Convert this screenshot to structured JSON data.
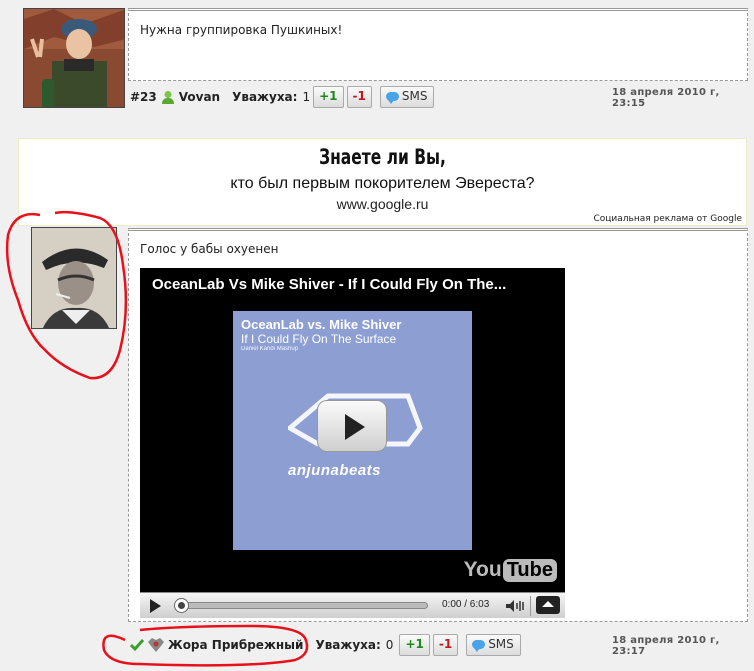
{
  "post1": {
    "message": "Нужна группировка Пушкиных!",
    "number": "#23",
    "username": "Vovan",
    "respect_label": "Уважуха:",
    "respect_value": "1",
    "plus_label": "+1",
    "minus_label": "-1",
    "sms_label": "SMS",
    "date": "18 апреля 2010 г, 23:15"
  },
  "ad": {
    "title": "Знаете ли Вы,",
    "text": "кто был первым покорителем Эвереста?",
    "url": "www.google.ru",
    "credit": "Социальная реклама от Google"
  },
  "post2": {
    "message": "Голос у бабы охуенен",
    "username": "Жора Прибрежный",
    "respect_label": "Уважуха:",
    "respect_value": "0",
    "plus_label": "+1",
    "minus_label": "-1",
    "sms_label": "SMS",
    "date": "18 апреля 2010 г, 23:17"
  },
  "video": {
    "title": "OceanLab Vs Mike Shiver - If I Could Fly On The...",
    "cover_artist": "OceanLab vs. Mike Shiver",
    "cover_title": "If I Could Fly On The Surface",
    "cover_subtitle": "Daniel Kandi Mashup",
    "label_logo": "anjunabeats",
    "yt_logo_you": "You",
    "yt_logo_tube": "Tube",
    "time": "0:00 / 6:03",
    "progress": 0
  },
  "colors": {
    "plus": "#1a8a1a",
    "minus": "#c01818",
    "highlight": "#e8101a",
    "cover_bg": "#8c9ed2"
  }
}
